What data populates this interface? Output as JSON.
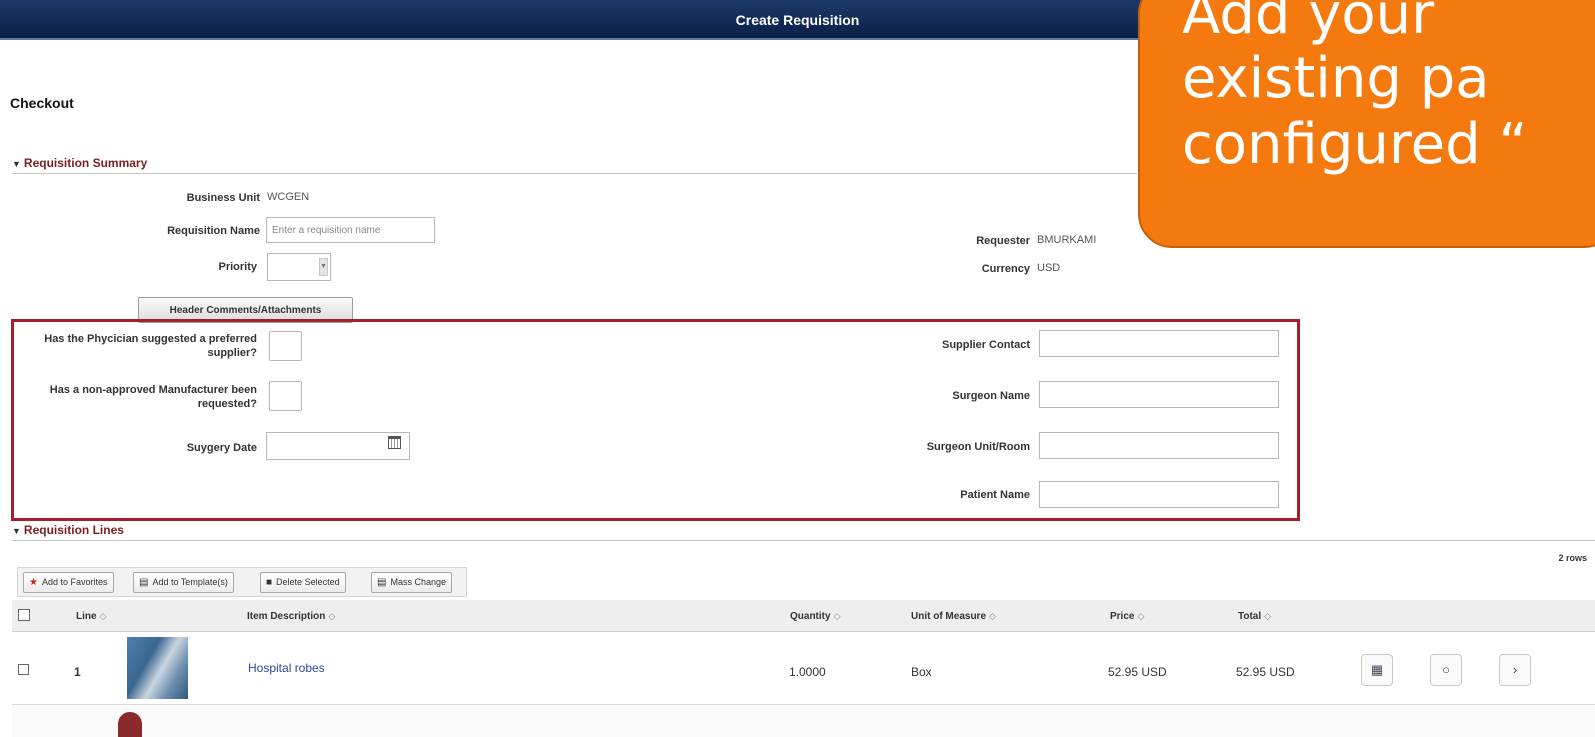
{
  "window": {
    "title": "Create Requisition"
  },
  "page": {
    "heading": "Checkout"
  },
  "summary": {
    "section_title": "Requisition Summary",
    "business_unit_label": "Business Unit",
    "business_unit_value": "WCGEN",
    "requisition_name_label": "Requisition Name",
    "requisition_name_placeholder": "Enter a requisition name",
    "priority_label": "Priority",
    "requester_label": "Requester",
    "requester_value": "BMURKAMI",
    "currency_label": "Currency",
    "currency_value": "USD",
    "header_comments_button": "Header Comments/Attachments"
  },
  "custom_fields": {
    "physician_supplier_line1": "Has the Phycician suggested a preferred",
    "physician_supplier_line2": "supplier?",
    "manufacturer_line1": "Has a non-approved Manufacturer been",
    "manufacturer_line2": "requested?",
    "surgery_date_label": "Suygery Date",
    "supplier_contact_label": "Supplier Contact",
    "surgeon_name_label": "Surgeon Name",
    "surgeon_unit_label": "Surgeon Unit/Room",
    "patient_name_label": "Patient Name"
  },
  "overlay": {
    "line1": "Add your",
    "line2": "existing pa",
    "line3": "configured “",
    "color": "#f47a0f"
  },
  "lines": {
    "section_title": "Requisition Lines",
    "rows_count": "2 rows",
    "toolbar": {
      "favorites": "Add to Favorites",
      "template": "Add to Template(s)",
      "delete": "Delete Selected",
      "mass_change": "Mass Change"
    },
    "columns": {
      "line": "Line",
      "item_description": "Item Description",
      "quantity": "Quantity",
      "uom": "Unit of Measure",
      "price": "Price",
      "total": "Total"
    },
    "rows": [
      {
        "line": "1",
        "item_description": "Hospital robes",
        "quantity": "1.0000",
        "uom": "Box",
        "price": "52.95 USD",
        "total": "52.95 USD"
      }
    ]
  },
  "colors": {
    "title_bar": "#0a1f45",
    "section_header": "#7a1f1f",
    "highlight_border": "#a51e2a",
    "link": "#2a4a9a"
  }
}
